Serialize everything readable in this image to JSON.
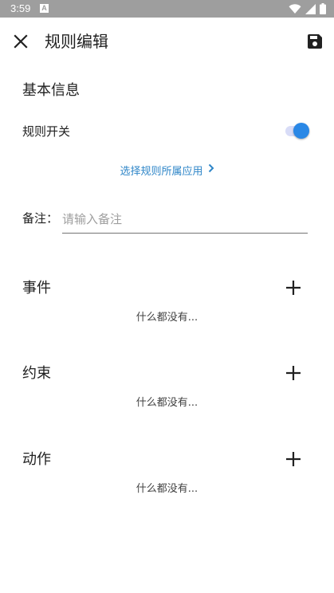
{
  "status_bar": {
    "time": "3:59",
    "notification_letter": "A"
  },
  "app_bar": {
    "title": "规则编辑",
    "close_icon": "close-icon",
    "save_icon": "save-icon"
  },
  "basic_info": {
    "title": "基本信息",
    "rule_switch_label": "规则开关",
    "rule_switch_on": true,
    "select_app_label": "选择规则所属应用",
    "remark_label": "备注：",
    "remark_placeholder": "请输入备注",
    "remark_value": ""
  },
  "sections": [
    {
      "title": "事件",
      "empty_text": "什么都没有..."
    },
    {
      "title": "约束",
      "empty_text": "什么都没有..."
    },
    {
      "title": "动作",
      "empty_text": "什么都没有..."
    }
  ],
  "colors": {
    "accent": "#2a88e6",
    "link": "#2f86c8",
    "status_bar": "#9e9e9e"
  }
}
